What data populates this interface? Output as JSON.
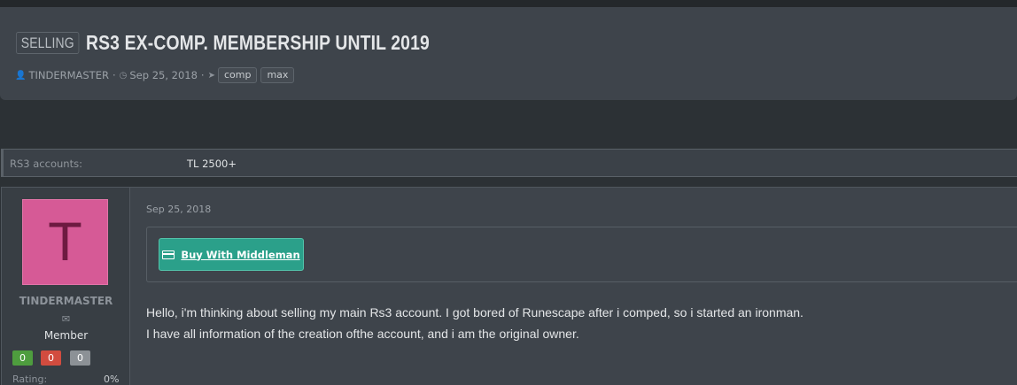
{
  "thread": {
    "prefix": "SELLING",
    "title": "RS3 EX-COMP. MEMBERSHIP UNTIL 2019",
    "author": "TINDERMASTER",
    "date": "Sep 25, 2018",
    "tags": [
      "comp",
      "max"
    ]
  },
  "custom_field": {
    "label": "RS3 accounts:",
    "value": "TL 2500+"
  },
  "post": {
    "username": "TINDERMASTER",
    "avatar_letter": "T",
    "user_title": "Member",
    "reputation": {
      "positive": "0",
      "negative": "0",
      "neutral": "0"
    },
    "rating_label": "Rating:",
    "rating_value": "0%",
    "date": "Sep 25, 2018",
    "middleman_button": "Buy With Middleman",
    "body_lines": [
      "Hello, i'm thinking about selling my main Rs3 account. I got bored of Runescape after i comped, so i started an ironman.",
      "I have all information of the creation ofthe account, and i am the original owner."
    ]
  },
  "colors": {
    "page_bg": "#2c3135",
    "panel_bg": "#3e444b",
    "avatar_bg": "#d65a96",
    "middleman_button": "#2ba08a",
    "rep_positive": "#4e9d3e",
    "rep_negative": "#d24c3f",
    "rep_neutral": "#8c9196"
  },
  "icons": {
    "author": "user-icon",
    "date": "clock-icon",
    "tags": "tags-icon",
    "message": "envelope-icon",
    "middleman": "credit-card-icon"
  }
}
